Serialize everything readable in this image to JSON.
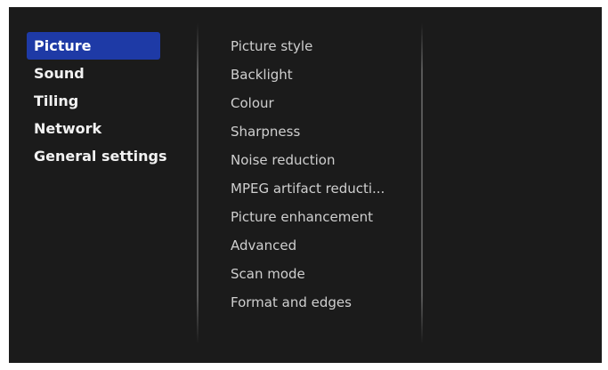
{
  "main_menu": {
    "items": [
      {
        "label": "Picture",
        "selected": true
      },
      {
        "label": "Sound",
        "selected": false
      },
      {
        "label": "Tiling",
        "selected": false
      },
      {
        "label": "Network",
        "selected": false
      },
      {
        "label": "General settings",
        "selected": false
      }
    ]
  },
  "sub_menu": {
    "items": [
      {
        "label": "Picture style"
      },
      {
        "label": "Backlight"
      },
      {
        "label": "Colour"
      },
      {
        "label": "Sharpness"
      },
      {
        "label": "Noise reduction"
      },
      {
        "label": "MPEG artifact reducti..."
      },
      {
        "label": "Picture enhancement"
      },
      {
        "label": "Advanced"
      },
      {
        "label": "Scan mode"
      },
      {
        "label": "Format and edges"
      }
    ]
  },
  "colors": {
    "background": "#1b1b1b",
    "selection": "#1e3aa6",
    "main_text": "#f2f2f2",
    "sub_text": "#cfcfcf"
  }
}
